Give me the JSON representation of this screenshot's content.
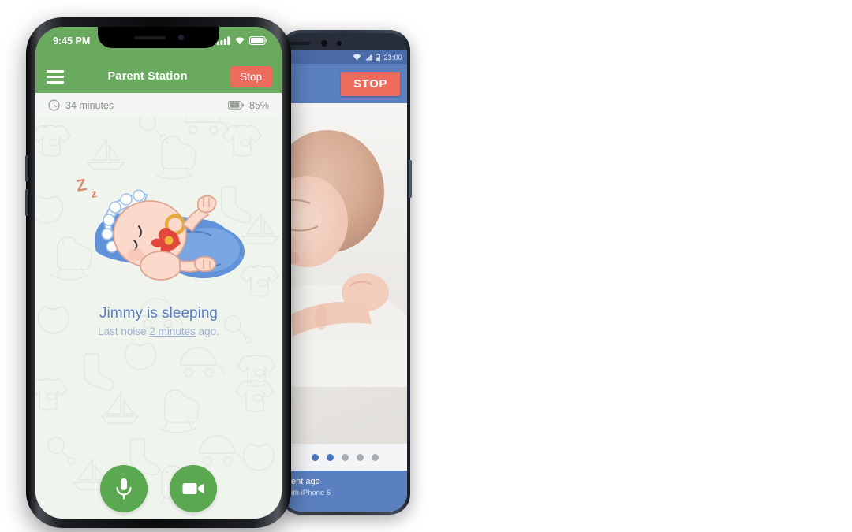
{
  "iphone": {
    "status": {
      "time": "9:45 PM",
      "signal_icon": "cellular-signal-icon",
      "wifi_icon": "wifi-icon",
      "battery_icon": "battery-icon"
    },
    "navbar": {
      "menu_icon": "hamburger-menu-icon",
      "title": "Parent Station",
      "stop_label": "Stop"
    },
    "infobar": {
      "clock_icon": "clock-icon",
      "duration": "34 minutes",
      "battery_icon": "battery-icon",
      "battery_percent": "85%"
    },
    "content": {
      "sleep_zzz": "Zz",
      "illustration": "sleeping-baby-illustration",
      "status_line": "Jimmy is sleeping",
      "last_noise_prefix": "Last noise ",
      "last_noise_value": "2 minutes",
      "last_noise_suffix": " ago."
    },
    "actions": {
      "mic_icon": "microphone-icon",
      "video_icon": "video-camera-icon"
    },
    "colors": {
      "header_green": "#6aaa5e",
      "stop_red": "#ec6b5b",
      "body_bg": "#eff4ed",
      "caption_blue": "#5a7fc4",
      "button_green": "#5aa84f"
    }
  },
  "android": {
    "status": {
      "wifi_icon": "wifi-icon",
      "signal_icon": "cellular-signal-icon",
      "battery_icon": "battery-icon",
      "time": "23:00"
    },
    "header": {
      "stop_label": "STOP"
    },
    "video": {
      "feed": "sleeping-baby-camera-feed"
    },
    "pager": {
      "total": 5,
      "active_dots": [
        0,
        1
      ]
    },
    "footer": {
      "line1": "ent ago",
      "line2": "ith  iPhone 6"
    },
    "colors": {
      "header_blue": "#5b80c0",
      "status_blue": "#4a6ba8",
      "stop_red": "#ec6b5b",
      "dot_active": "#4a73bd",
      "dot_inactive": "#a8abb0"
    }
  }
}
